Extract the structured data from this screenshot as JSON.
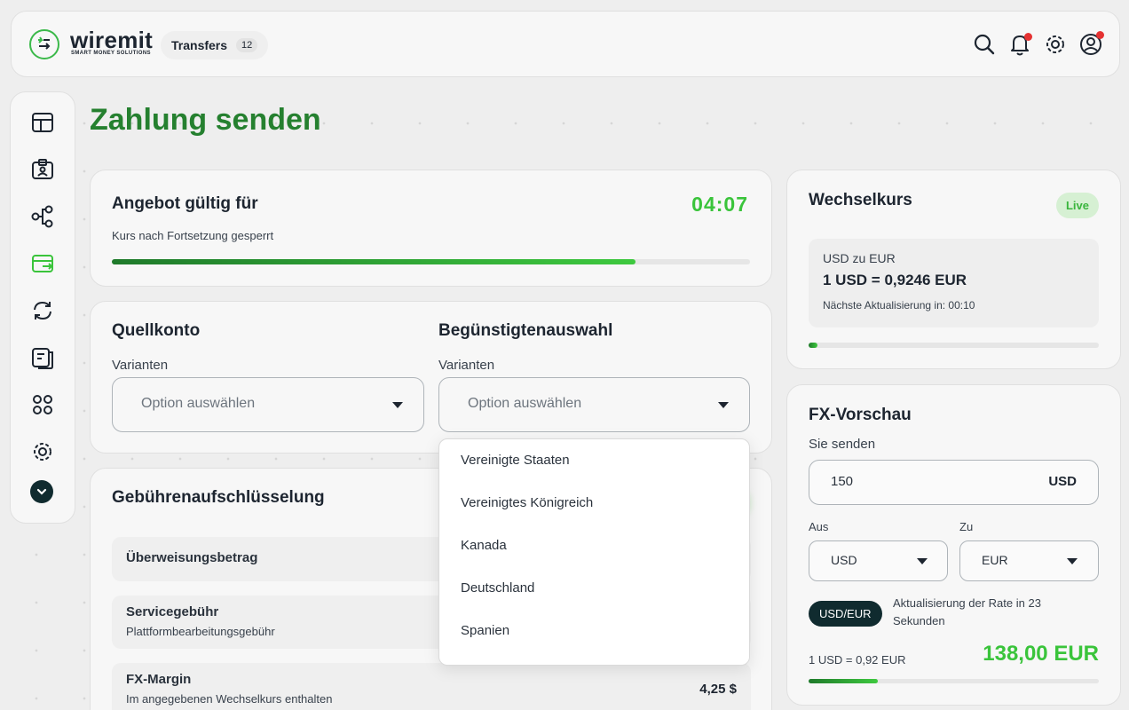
{
  "brand": {
    "name": "wiremit",
    "tagline": "SMART MONEY SOLUTIONS",
    "accent": "#3ac43b",
    "dark": "#102b2f"
  },
  "header": {
    "transfers_label": "Transfers",
    "transfers_count": "12",
    "icons": [
      "search-icon",
      "bell-icon",
      "gear-icon",
      "user-icon"
    ]
  },
  "sidebar": {
    "items": [
      "dashboard-icon",
      "wallet-icon",
      "network-icon",
      "send-card-icon",
      "exchange-icon",
      "documents-icon",
      "apps-icon",
      "settings-icon",
      "chevron-down-icon"
    ],
    "active": "send-card-icon"
  },
  "page": {
    "title": "Zahlung senden"
  },
  "offer": {
    "title": "Angebot gültig für",
    "subtitle": "Kurs nach Fortsetzung gesperrt",
    "timer": "04:07",
    "progress": 0.82
  },
  "source": {
    "title": "Quellkonto",
    "label": "Varianten",
    "placeholder": "Option auswählen"
  },
  "beneficiary": {
    "title": "Begünstigtenauswahl",
    "label": "Varianten",
    "placeholder": "Option auswählen",
    "options": [
      "Vereinigte Staaten",
      "Vereinigtes Königreich",
      "Kanada",
      "Deutschland",
      "Spanien"
    ]
  },
  "fees": {
    "title": "Gebührenaufschlüsselung",
    "rows": [
      {
        "title": "Überweisungsbetrag",
        "subtitle": "",
        "value": ""
      },
      {
        "title": "Servicegebühr",
        "subtitle": "Plattformbearbeitungsgebühr",
        "value": ""
      },
      {
        "title": "FX-Margin",
        "subtitle": "Im angegebenen Wechselkurs enthalten",
        "value": "4,25 $"
      }
    ]
  },
  "rate": {
    "title": "Wechselkurs",
    "live": "Live",
    "pair_label": "USD zu EUR",
    "value": "1 USD = 0,9246 EUR",
    "next_update": "Nächste Aktualisierung in: 00:10",
    "progress": 0.03
  },
  "fx": {
    "title": "FX-Vorschau",
    "send_label": "Sie senden",
    "amount": "150",
    "currency": "USD",
    "from_label": "Aus",
    "from_value": "USD",
    "to_label": "Zu",
    "to_value": "EUR",
    "pair": "USD/EUR",
    "update_text": "Aktualisierung der Rate in 23 Sekunden",
    "rate_text": "1 USD = 0,92 EUR",
    "total": "138,00 EUR",
    "progress": 0.24
  }
}
